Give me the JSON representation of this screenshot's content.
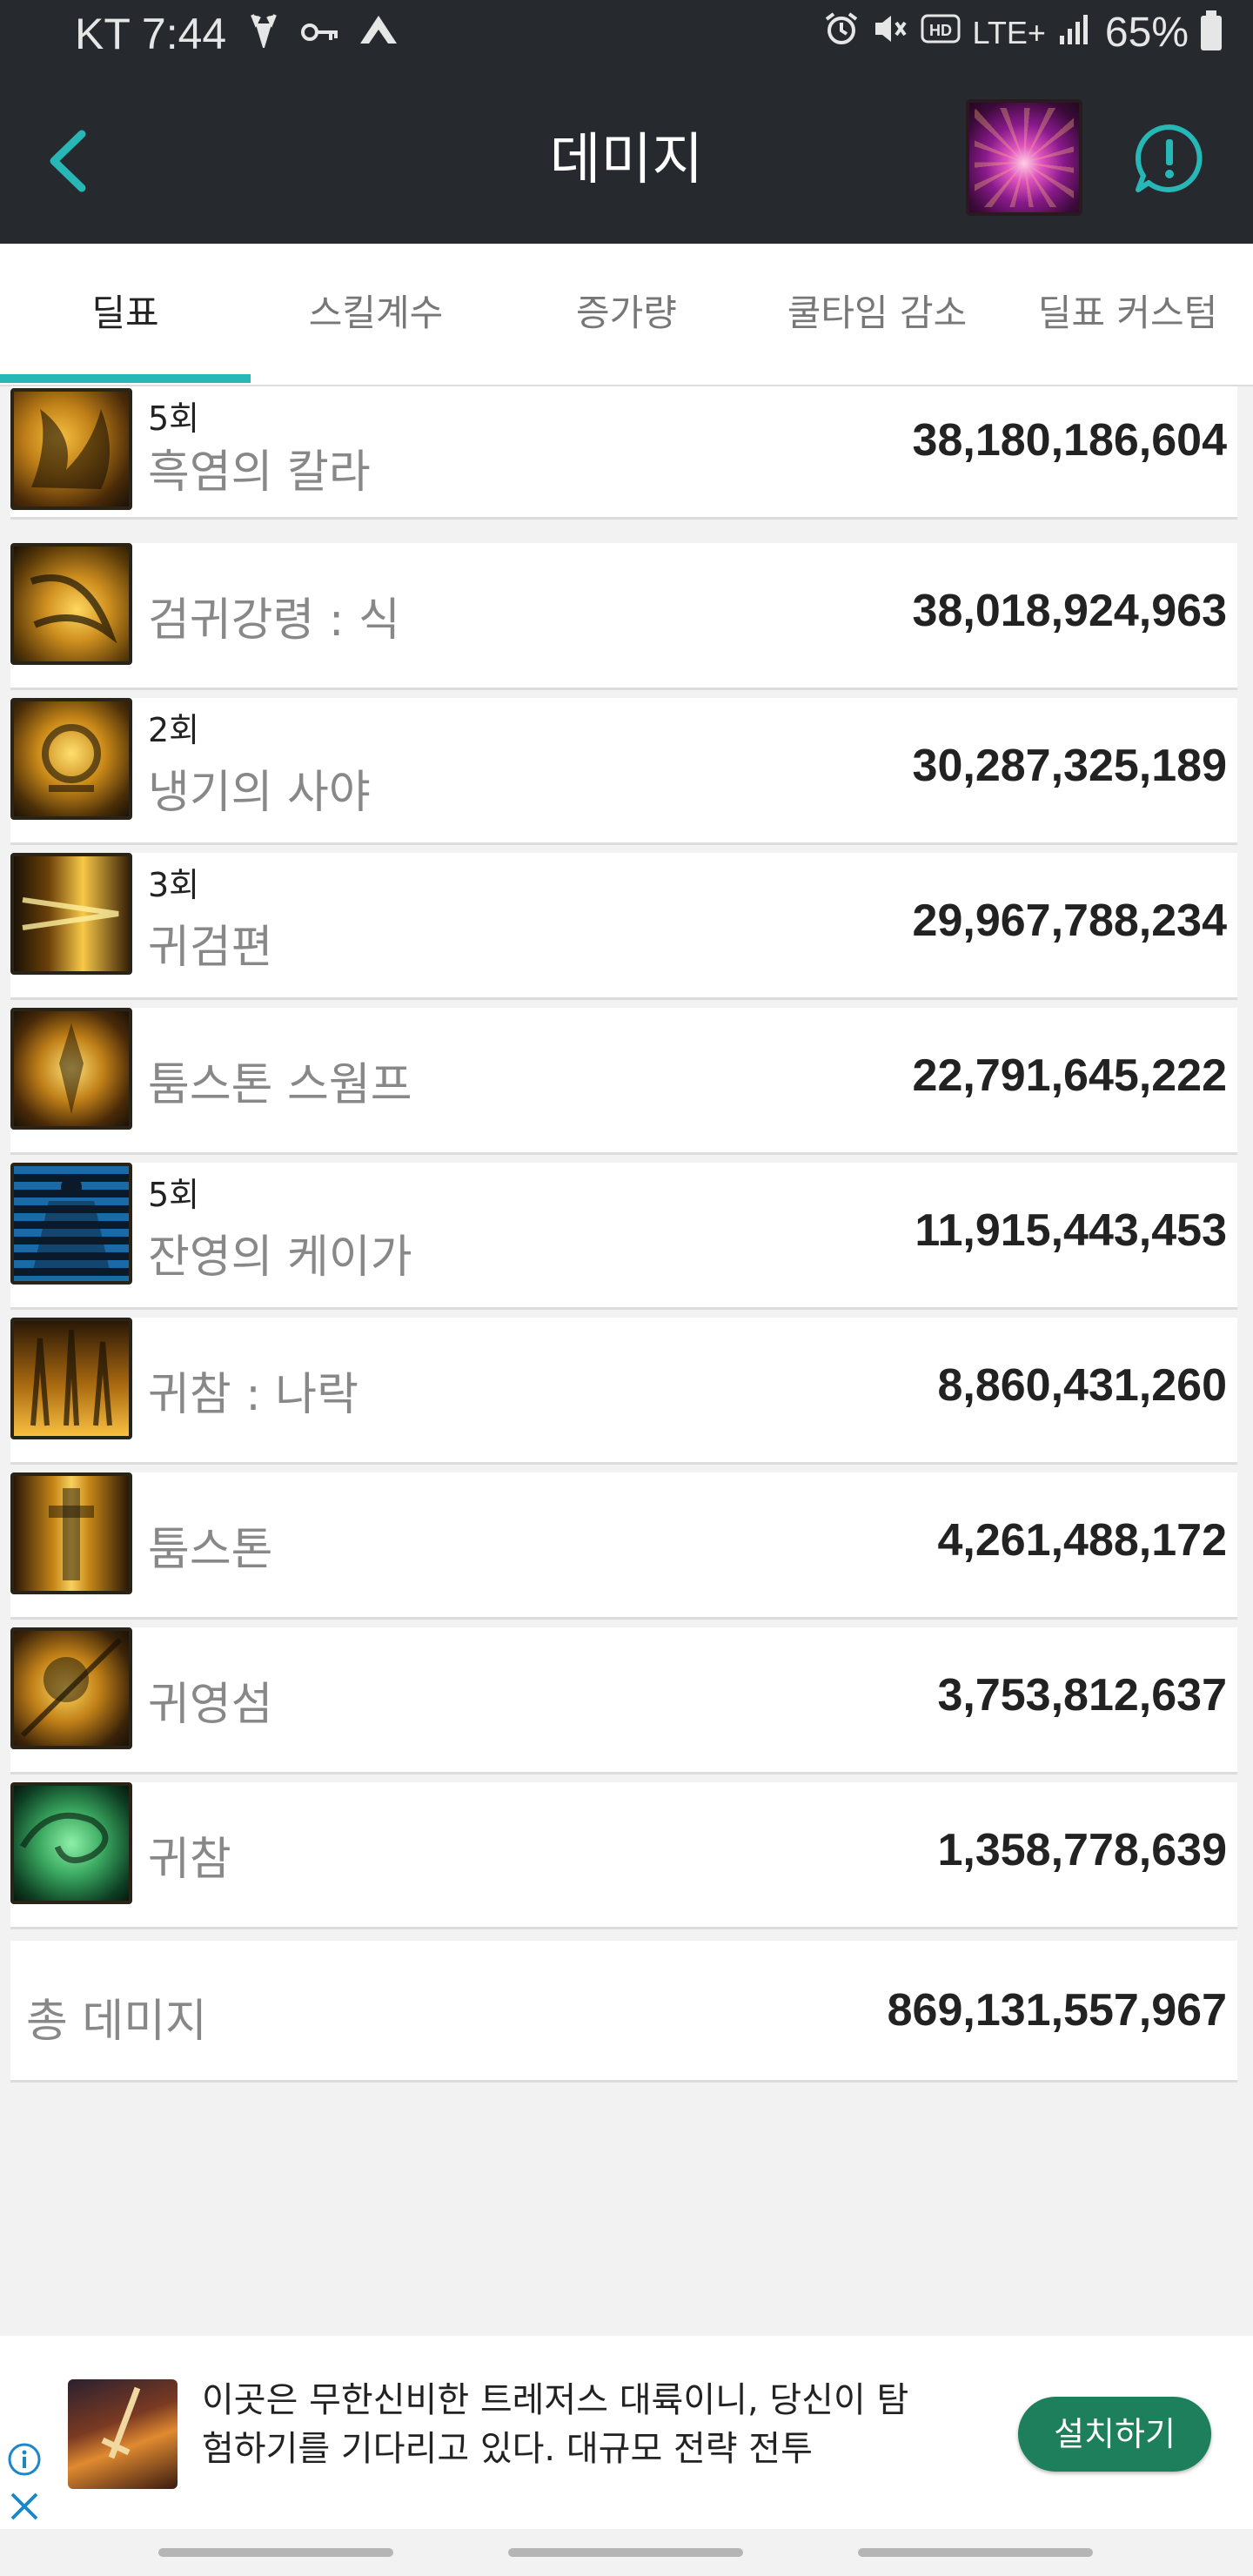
{
  "status_bar": {
    "carrier_time": "KT 7:44",
    "network": "LTE+",
    "battery": "65%",
    "left_icons": [
      "deer-icon",
      "key-icon",
      "mountain-icon"
    ],
    "right_icons": [
      "alarm-icon",
      "mute-icon",
      "hd-icon",
      "signal-icon",
      "battery-icon"
    ]
  },
  "header": {
    "title": "데미지",
    "accent_color": "#26b7b6"
  },
  "tabs": [
    {
      "label": "딜표",
      "active": true
    },
    {
      "label": "스킬계수",
      "active": false
    },
    {
      "label": "증가량",
      "active": false
    },
    {
      "label": "쿨타임 감소",
      "active": false
    },
    {
      "label": "딜표 커스텀",
      "active": false
    }
  ],
  "skills": [
    {
      "count": "5회",
      "name": "흑염의 칼라",
      "damage": "38,180,186,604",
      "icon": "black-flame-icon"
    },
    {
      "count": "",
      "name": "검귀강령 : 식",
      "damage": "38,018,924,963",
      "icon": "sword-spirit-icon"
    },
    {
      "count": "2회",
      "name": "냉기의 사야",
      "damage": "30,287,325,189",
      "icon": "cold-spirit-icon"
    },
    {
      "count": "3회",
      "name": "귀검편",
      "damage": "29,967,788,234",
      "icon": "ghost-sword-icon"
    },
    {
      "count": "",
      "name": "툼스톤 스웜프",
      "damage": "22,791,645,222",
      "icon": "tombstone-swamp-icon"
    },
    {
      "count": "5회",
      "name": "잔영의 케이가",
      "damage": "11,915,443,453",
      "icon": "afterimage-icon"
    },
    {
      "count": "",
      "name": "귀참 : 나락",
      "damage": "8,860,431,260",
      "icon": "ghost-slash-abyss-icon"
    },
    {
      "count": "",
      "name": "툼스톤",
      "damage": "4,261,488,172",
      "icon": "tombstone-icon"
    },
    {
      "count": "",
      "name": "귀영섬",
      "damage": "3,753,812,637",
      "icon": "ghost-flash-icon"
    },
    {
      "count": "",
      "name": "귀참",
      "damage": "1,358,778,639",
      "icon": "ghost-slash-icon"
    }
  ],
  "total": {
    "label": "총 데미지",
    "damage": "869,131,557,967"
  },
  "ad": {
    "text": "이곳은 무한신비한 트레저스 대륙이니, 당신이 탐험하기를 기다리고 있다. 대규모 전략 전투",
    "install_label": "설치하기",
    "install_color": "#1d7f5c"
  }
}
